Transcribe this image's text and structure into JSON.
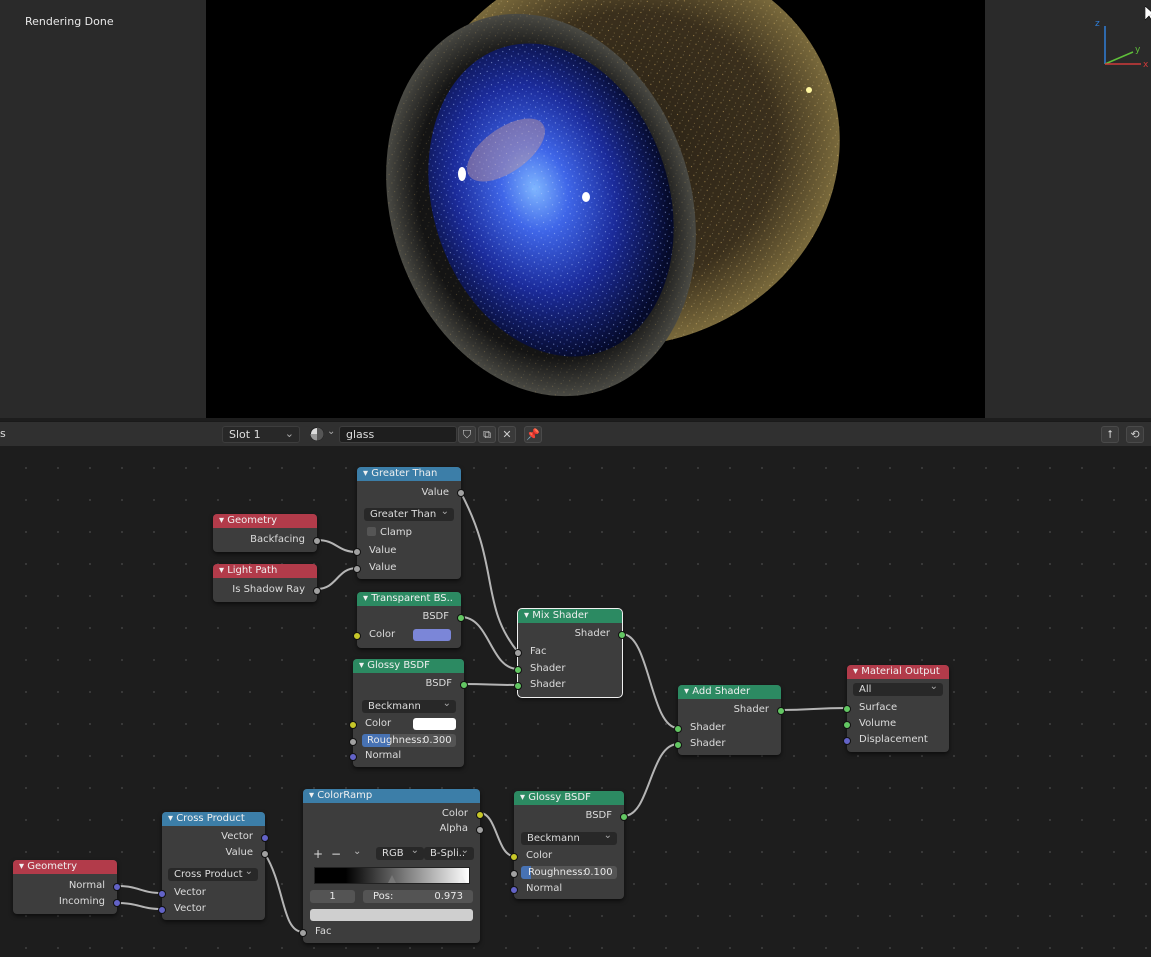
{
  "render": {
    "status": "Rendering Done"
  },
  "header": {
    "left_fragment": "s",
    "slot": "Slot 1",
    "material_name": "glass"
  },
  "colors": {
    "node_input_header": "#b23b4a",
    "node_converter_header": "#3c7ea8",
    "node_shader_header": "#2c8a62",
    "socket_shader": "#63c763",
    "socket_color": "#c7c729",
    "socket_float": "#a1a1a1",
    "socket_vector": "#6363c7",
    "transparent_color": "#7b86d8",
    "glossy1_color": "#ffffff"
  },
  "nodes": {
    "geometry1": {
      "title": "Geometry",
      "out_backfacing": "Backfacing"
    },
    "lightpath": {
      "title": "Light Path",
      "out_shadow": "Is Shadow Ray"
    },
    "greaterthan": {
      "title": "Greater Than",
      "out_value": "Value",
      "op": "Greater Than",
      "clamp": "Clamp",
      "in_value1": "Value",
      "in_value2": "Value"
    },
    "transparent": {
      "title": "Transparent BS..",
      "out_bsdf": "BSDF",
      "in_color": "Color"
    },
    "glossy1": {
      "title": "Glossy BSDF",
      "out_bsdf": "BSDF",
      "dist": "Beckmann",
      "in_color": "Color",
      "rough_label": "Roughness:",
      "rough_value": "0.300",
      "roughness": 0.3,
      "in_normal": "Normal"
    },
    "mixshader": {
      "title": "Mix Shader",
      "out_shader": "Shader",
      "in_fac": "Fac",
      "in_shader1": "Shader",
      "in_shader2": "Shader"
    },
    "addshader": {
      "title": "Add Shader",
      "out_shader": "Shader",
      "in_shader1": "Shader",
      "in_shader2": "Shader"
    },
    "output": {
      "title": "Material Output",
      "target": "All",
      "in_surface": "Surface",
      "in_volume": "Volume",
      "in_displacement": "Displacement"
    },
    "geometry2": {
      "title": "Geometry",
      "out_normal": "Normal",
      "out_incoming": "Incoming"
    },
    "crossproduct": {
      "title": "Cross Product",
      "out_vector": "Vector",
      "out_value": "Value",
      "op": "Cross Product",
      "in_vector1": "Vector",
      "in_vector2": "Vector"
    },
    "colorramp": {
      "title": "ColorRamp",
      "out_color": "Color",
      "out_alpha": "Alpha",
      "plus": "+",
      "minus": "−",
      "mode": "RGB",
      "interp": "B-Spli..",
      "index": "1",
      "pos_label": "Pos:",
      "pos_value": "0.973",
      "in_fac": "Fac"
    },
    "glossy2": {
      "title": "Glossy BSDF",
      "out_bsdf": "BSDF",
      "dist": "Beckmann",
      "in_color": "Color",
      "rough_label": "Roughness:",
      "rough_value": "0.100",
      "roughness": 0.1,
      "in_normal": "Normal"
    }
  }
}
